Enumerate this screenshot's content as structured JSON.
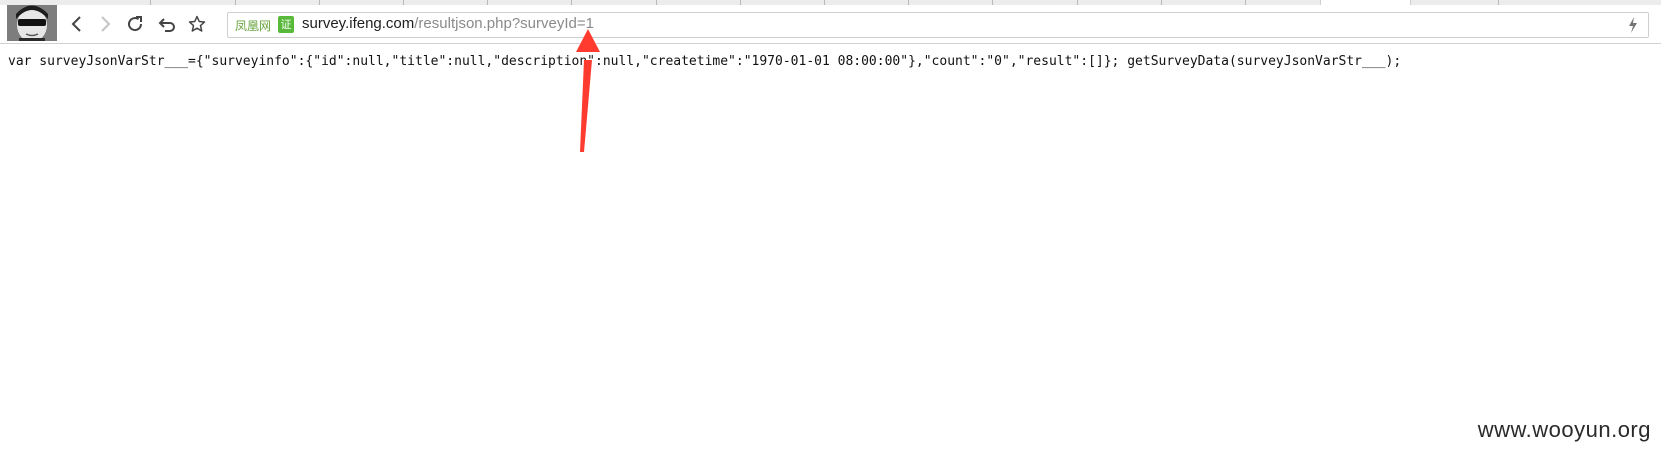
{
  "addressbar": {
    "site_name": "凤凰网",
    "cert_label": "证",
    "url_host": "survey.ifeng.com",
    "url_path": "/resultjson.php?surveyId=1"
  },
  "page": {
    "content_text": "var surveyJsonVarStr___={\"surveyinfo\":{\"id\":null,\"title\":null,\"description\":null,\"createtime\":\"1970-01-01 08:00:00\"},\"count\":\"0\",\"result\":[]}; getSurveyData(surveyJsonVarStr___);"
  },
  "watermark": {
    "text": "www.wooyun.org"
  },
  "icons": {
    "back": "back-arrow-icon",
    "forward": "forward-arrow-icon",
    "reload": "reload-icon",
    "undo": "undo-icon",
    "star": "star-icon",
    "bolt": "lightning-icon",
    "annotation": "red-arrow-annotation"
  },
  "colors": {
    "annotation_red": "#ff3b30",
    "site_green": "#6aa53f",
    "cert_green": "#59b93a"
  }
}
